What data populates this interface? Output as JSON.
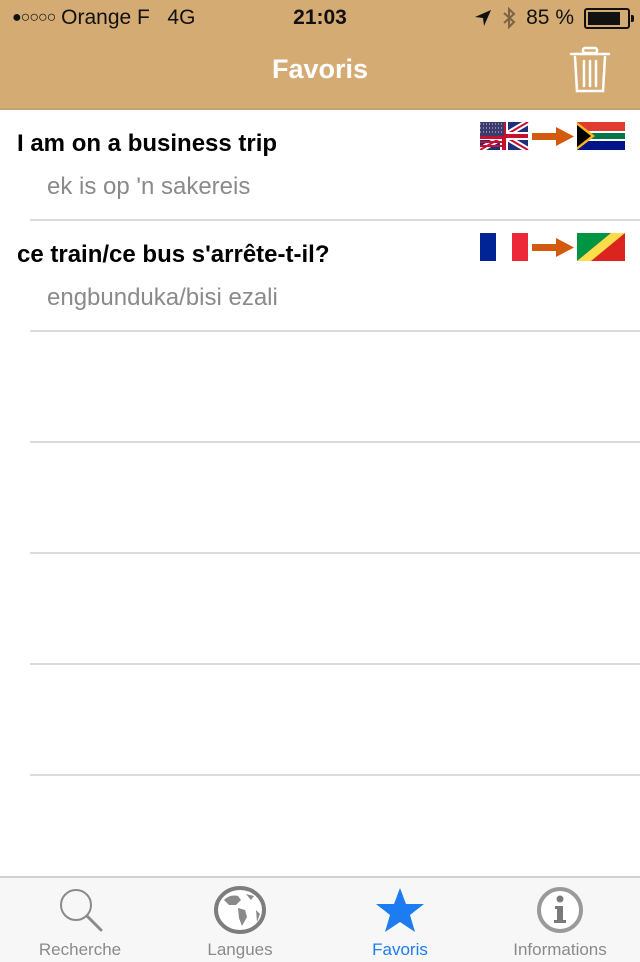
{
  "status_bar": {
    "signal": "●○○○○",
    "carrier": "Orange F",
    "network": "4G",
    "time": "21:03",
    "battery_text": "85 %",
    "battery_level": 0.85,
    "icons": [
      "location-arrow-icon",
      "bluetooth-icon",
      "battery-icon"
    ]
  },
  "header": {
    "title": "Favoris",
    "trash_icon": "trash-icon",
    "bar_color": "#d5ab74"
  },
  "favorites": [
    {
      "source": "I am on a business trip",
      "translation": "ek is op 'n sakereis",
      "from_flag": "flag-uk-us",
      "to_flag": "flag-south-africa"
    },
    {
      "source": "ce train/ce bus s'arrête-t-il?",
      "translation": "engbunduka/bisi ezali",
      "from_flag": "flag-france",
      "to_flag": "flag-congo"
    }
  ],
  "tabbar": {
    "active_color": "#1d7cf2",
    "tabs": [
      {
        "label": "Recherche",
        "icon": "search-icon",
        "active": false
      },
      {
        "label": "Langues",
        "icon": "globe-icon",
        "active": false
      },
      {
        "label": "Favoris",
        "icon": "star-icon",
        "active": true
      },
      {
        "label": "Informations",
        "icon": "info-icon",
        "active": false
      }
    ]
  }
}
